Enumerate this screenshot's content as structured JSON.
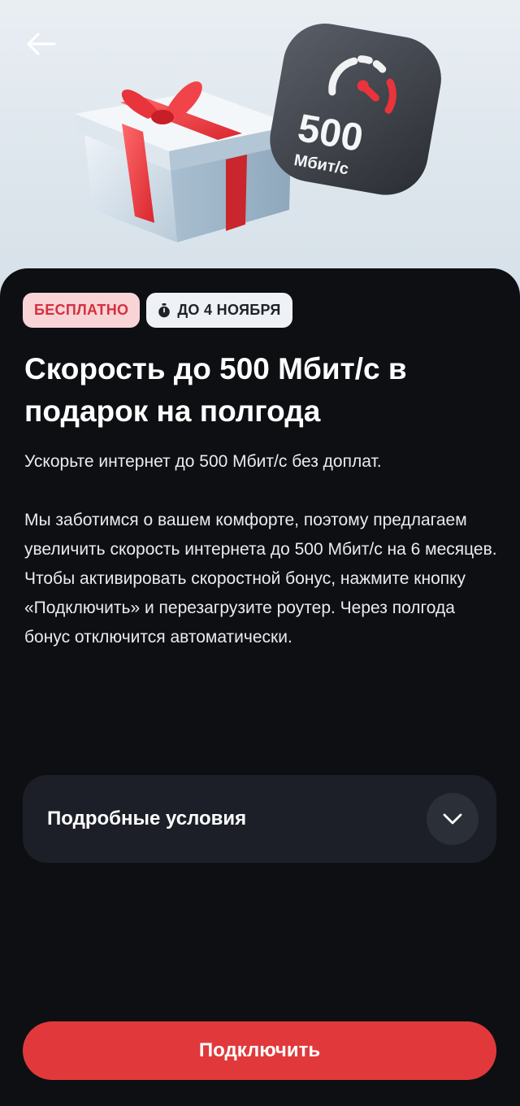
{
  "hero": {
    "back_icon": "arrow-left-icon",
    "speed_tile": {
      "value": "500",
      "unit": "Мбит/с",
      "icon": "speedometer-icon"
    },
    "gift_icon": "gift-box-illustration"
  },
  "tags": {
    "free": "БЕСПЛАТНО",
    "deadline": "ДО 4 НОЯБРЯ",
    "deadline_icon": "stopwatch-icon"
  },
  "title": "Скорость до 500 Мбит/с в подарок на полгода",
  "description": {
    "lead": "Ускорьте интернет до 500 Мбит/с без доплат.",
    "body": "Мы заботимся о вашем комфорте, поэтому предлагаем увеличить скорость интернета до 500 Мбит/с на 6 месяцев.\nЧтобы активировать скоростной бонус, нажмите кнопку «Подключить» и перезагрузите роутер. Через полгода бонус отключится автоматически."
  },
  "terms": {
    "label": "Подробные условия",
    "icon": "chevron-down-icon"
  },
  "cta": {
    "label": "Подключить"
  },
  "colors": {
    "accent": "#e1393b",
    "free_tag_bg": "#f8d4d7",
    "free_tag_text": "#d5303d",
    "sheet_bg": "#0e0f13",
    "card_bg": "#1c1f27"
  }
}
